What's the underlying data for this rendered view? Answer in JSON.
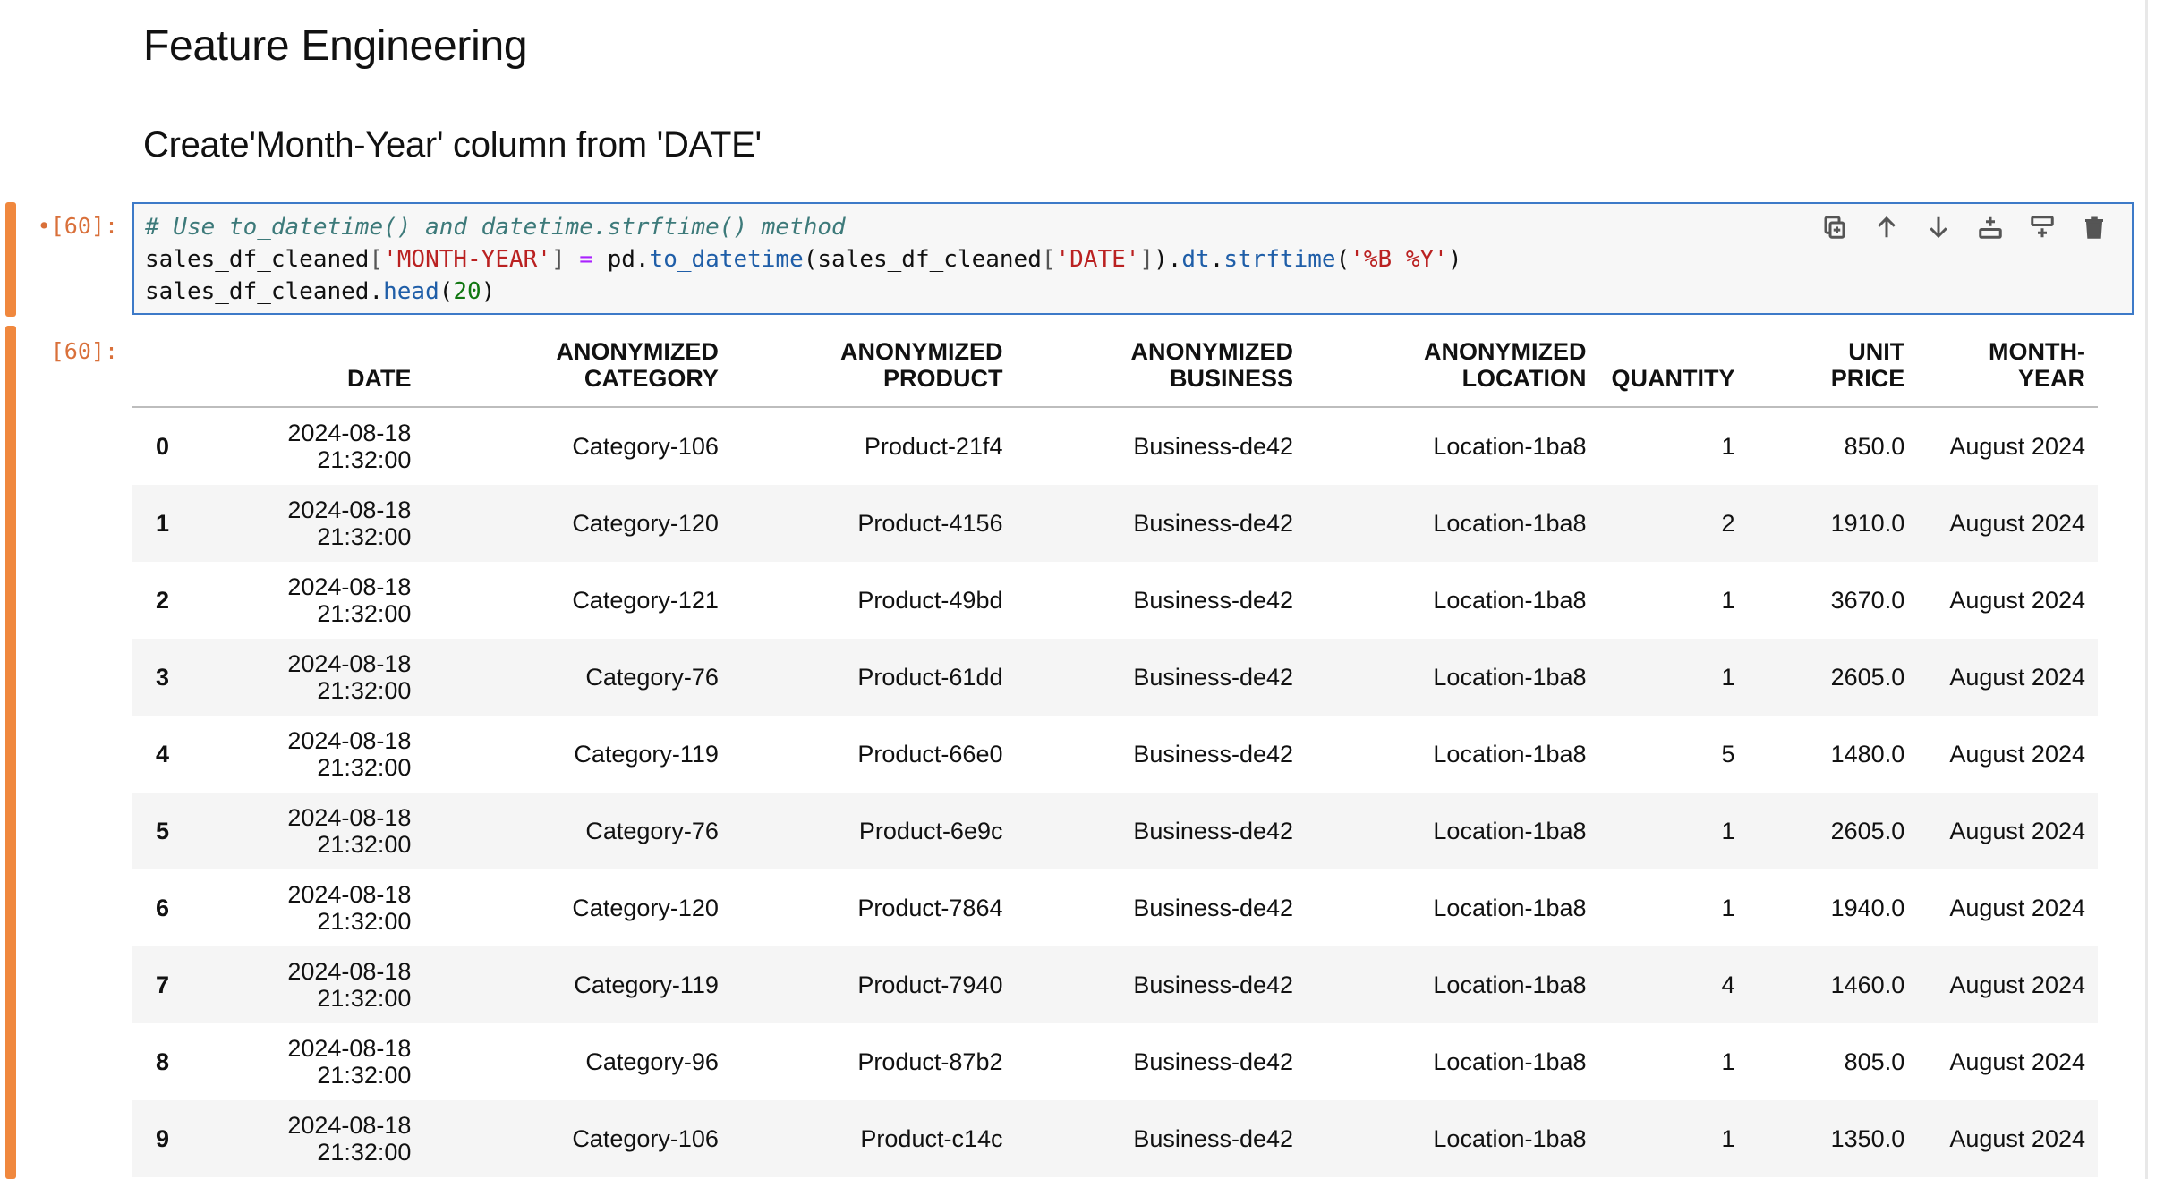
{
  "markdown": {
    "heading1": "Feature Engineering",
    "heading2": "Create'Month-Year' column from 'DATE'"
  },
  "cell": {
    "dirty_marker": "•",
    "in_prompt": "[60]:",
    "out_prompt": "[60]:",
    "code": {
      "comment": "# Use to_datetime() and datetime.strftime() method",
      "l2_var": "sales_df_cleaned",
      "l2_bracket_open": "[",
      "l2_key": "'MONTH-YEAR'",
      "l2_bracket_close": "]",
      "l2_eq": " = ",
      "l2_pd": "pd.",
      "l2_fn1": "to_datetime",
      "l2_arg_open": "(sales_df_cleaned",
      "l2_b2_open": "[",
      "l2_key2": "'DATE'",
      "l2_b2_close": "]",
      "l2_after": ").",
      "l2_dt": "dt",
      "l2_dot": ".",
      "l2_fn2": "strftime",
      "l2_paren_open": "(",
      "l2_fmt": "'%B %Y'",
      "l2_paren_close": ")",
      "l3_var": "sales_df_cleaned.",
      "l3_fn": "head",
      "l3_open": "(",
      "l3_num": "20",
      "l3_close": ")"
    },
    "toolbar": {
      "icons": [
        "duplicate-icon",
        "move-up-icon",
        "move-down-icon",
        "insert-above-icon",
        "insert-below-icon",
        "delete-icon"
      ]
    }
  },
  "table": {
    "headers": [
      {
        "l1": "",
        "l2": ""
      },
      {
        "l1": "",
        "l2": "DATE"
      },
      {
        "l1": "ANONYMIZED",
        "l2": "CATEGORY"
      },
      {
        "l1": "ANONYMIZED",
        "l2": "PRODUCT"
      },
      {
        "l1": "ANONYMIZED",
        "l2": "BUSINESS"
      },
      {
        "l1": "ANONYMIZED",
        "l2": "LOCATION"
      },
      {
        "l1": "",
        "l2": "QUANTITY"
      },
      {
        "l1": "UNIT",
        "l2": "PRICE"
      },
      {
        "l1": "",
        "l2": "MONTH-YEAR"
      }
    ],
    "rows": [
      {
        "idx": "0",
        "date": "2024-08-18",
        "time": "21:32:00",
        "category": "Category-106",
        "product": "Product-21f4",
        "business": "Business-de42",
        "location": "Location-1ba8",
        "quantity": "1",
        "price": "850.0",
        "month_year": "August 2024"
      },
      {
        "idx": "1",
        "date": "2024-08-18",
        "time": "21:32:00",
        "category": "Category-120",
        "product": "Product-4156",
        "business": "Business-de42",
        "location": "Location-1ba8",
        "quantity": "2",
        "price": "1910.0",
        "month_year": "August 2024"
      },
      {
        "idx": "2",
        "date": "2024-08-18",
        "time": "21:32:00",
        "category": "Category-121",
        "product": "Product-49bd",
        "business": "Business-de42",
        "location": "Location-1ba8",
        "quantity": "1",
        "price": "3670.0",
        "month_year": "August 2024"
      },
      {
        "idx": "3",
        "date": "2024-08-18",
        "time": "21:32:00",
        "category": "Category-76",
        "product": "Product-61dd",
        "business": "Business-de42",
        "location": "Location-1ba8",
        "quantity": "1",
        "price": "2605.0",
        "month_year": "August 2024"
      },
      {
        "idx": "4",
        "date": "2024-08-18",
        "time": "21:32:00",
        "category": "Category-119",
        "product": "Product-66e0",
        "business": "Business-de42",
        "location": "Location-1ba8",
        "quantity": "5",
        "price": "1480.0",
        "month_year": "August 2024"
      },
      {
        "idx": "5",
        "date": "2024-08-18",
        "time": "21:32:00",
        "category": "Category-76",
        "product": "Product-6e9c",
        "business": "Business-de42",
        "location": "Location-1ba8",
        "quantity": "1",
        "price": "2605.0",
        "month_year": "August 2024"
      },
      {
        "idx": "6",
        "date": "2024-08-18",
        "time": "21:32:00",
        "category": "Category-120",
        "product": "Product-7864",
        "business": "Business-de42",
        "location": "Location-1ba8",
        "quantity": "1",
        "price": "1940.0",
        "month_year": "August 2024"
      },
      {
        "idx": "7",
        "date": "2024-08-18",
        "time": "21:32:00",
        "category": "Category-119",
        "product": "Product-7940",
        "business": "Business-de42",
        "location": "Location-1ba8",
        "quantity": "4",
        "price": "1460.0",
        "month_year": "August 2024"
      },
      {
        "idx": "8",
        "date": "2024-08-18",
        "time": "21:32:00",
        "category": "Category-96",
        "product": "Product-87b2",
        "business": "Business-de42",
        "location": "Location-1ba8",
        "quantity": "1",
        "price": "805.0",
        "month_year": "August 2024"
      },
      {
        "idx": "9",
        "date": "2024-08-18",
        "time": "21:32:00",
        "category": "Category-106",
        "product": "Product-c14c",
        "business": "Business-de42",
        "location": "Location-1ba8",
        "quantity": "1",
        "price": "1350.0",
        "month_year": "August 2024"
      }
    ]
  }
}
